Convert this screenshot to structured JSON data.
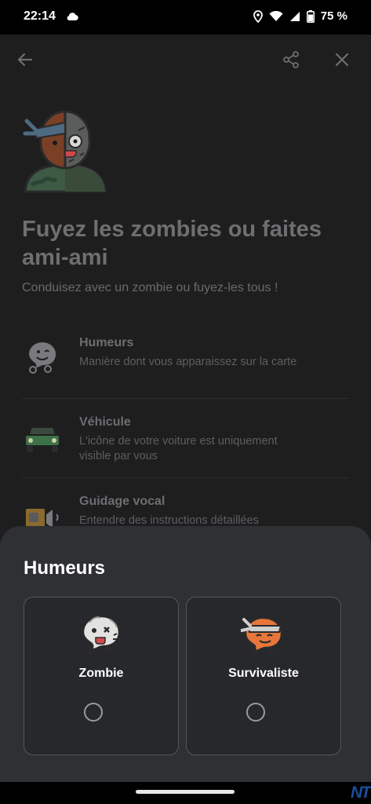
{
  "status_bar": {
    "time": "22:14",
    "battery_text": "75 %"
  },
  "header": {
    "title": "Fuyez les zombies ou faites ami-ami",
    "subtitle": "Conduisez avec un zombie ou fuyez-les tous !"
  },
  "settings": [
    {
      "title": "Humeurs",
      "desc": "Manière dont vous apparaissez sur la carte",
      "icon": "mood-icon"
    },
    {
      "title": "Véhicule",
      "desc": "L'icône de votre voiture est uniquement visible par vous",
      "icon": "car-icon"
    },
    {
      "title": "Guidage vocal",
      "desc": "Entendre des instructions détaillées",
      "icon": "voice-guidance-icon"
    }
  ],
  "sheet": {
    "title": "Humeurs",
    "options": [
      {
        "name": "Zombie",
        "icon": "zombie-mood-icon",
        "selected": false
      },
      {
        "name": "Survivaliste",
        "icon": "survivalist-mood-icon",
        "selected": false
      }
    ]
  },
  "watermark": "NT",
  "colors": {
    "background": "#1e1e1f",
    "sheet": "#2f3033",
    "zombie_green": "#3d8c5a",
    "survivor_orange": "#e8763a"
  }
}
